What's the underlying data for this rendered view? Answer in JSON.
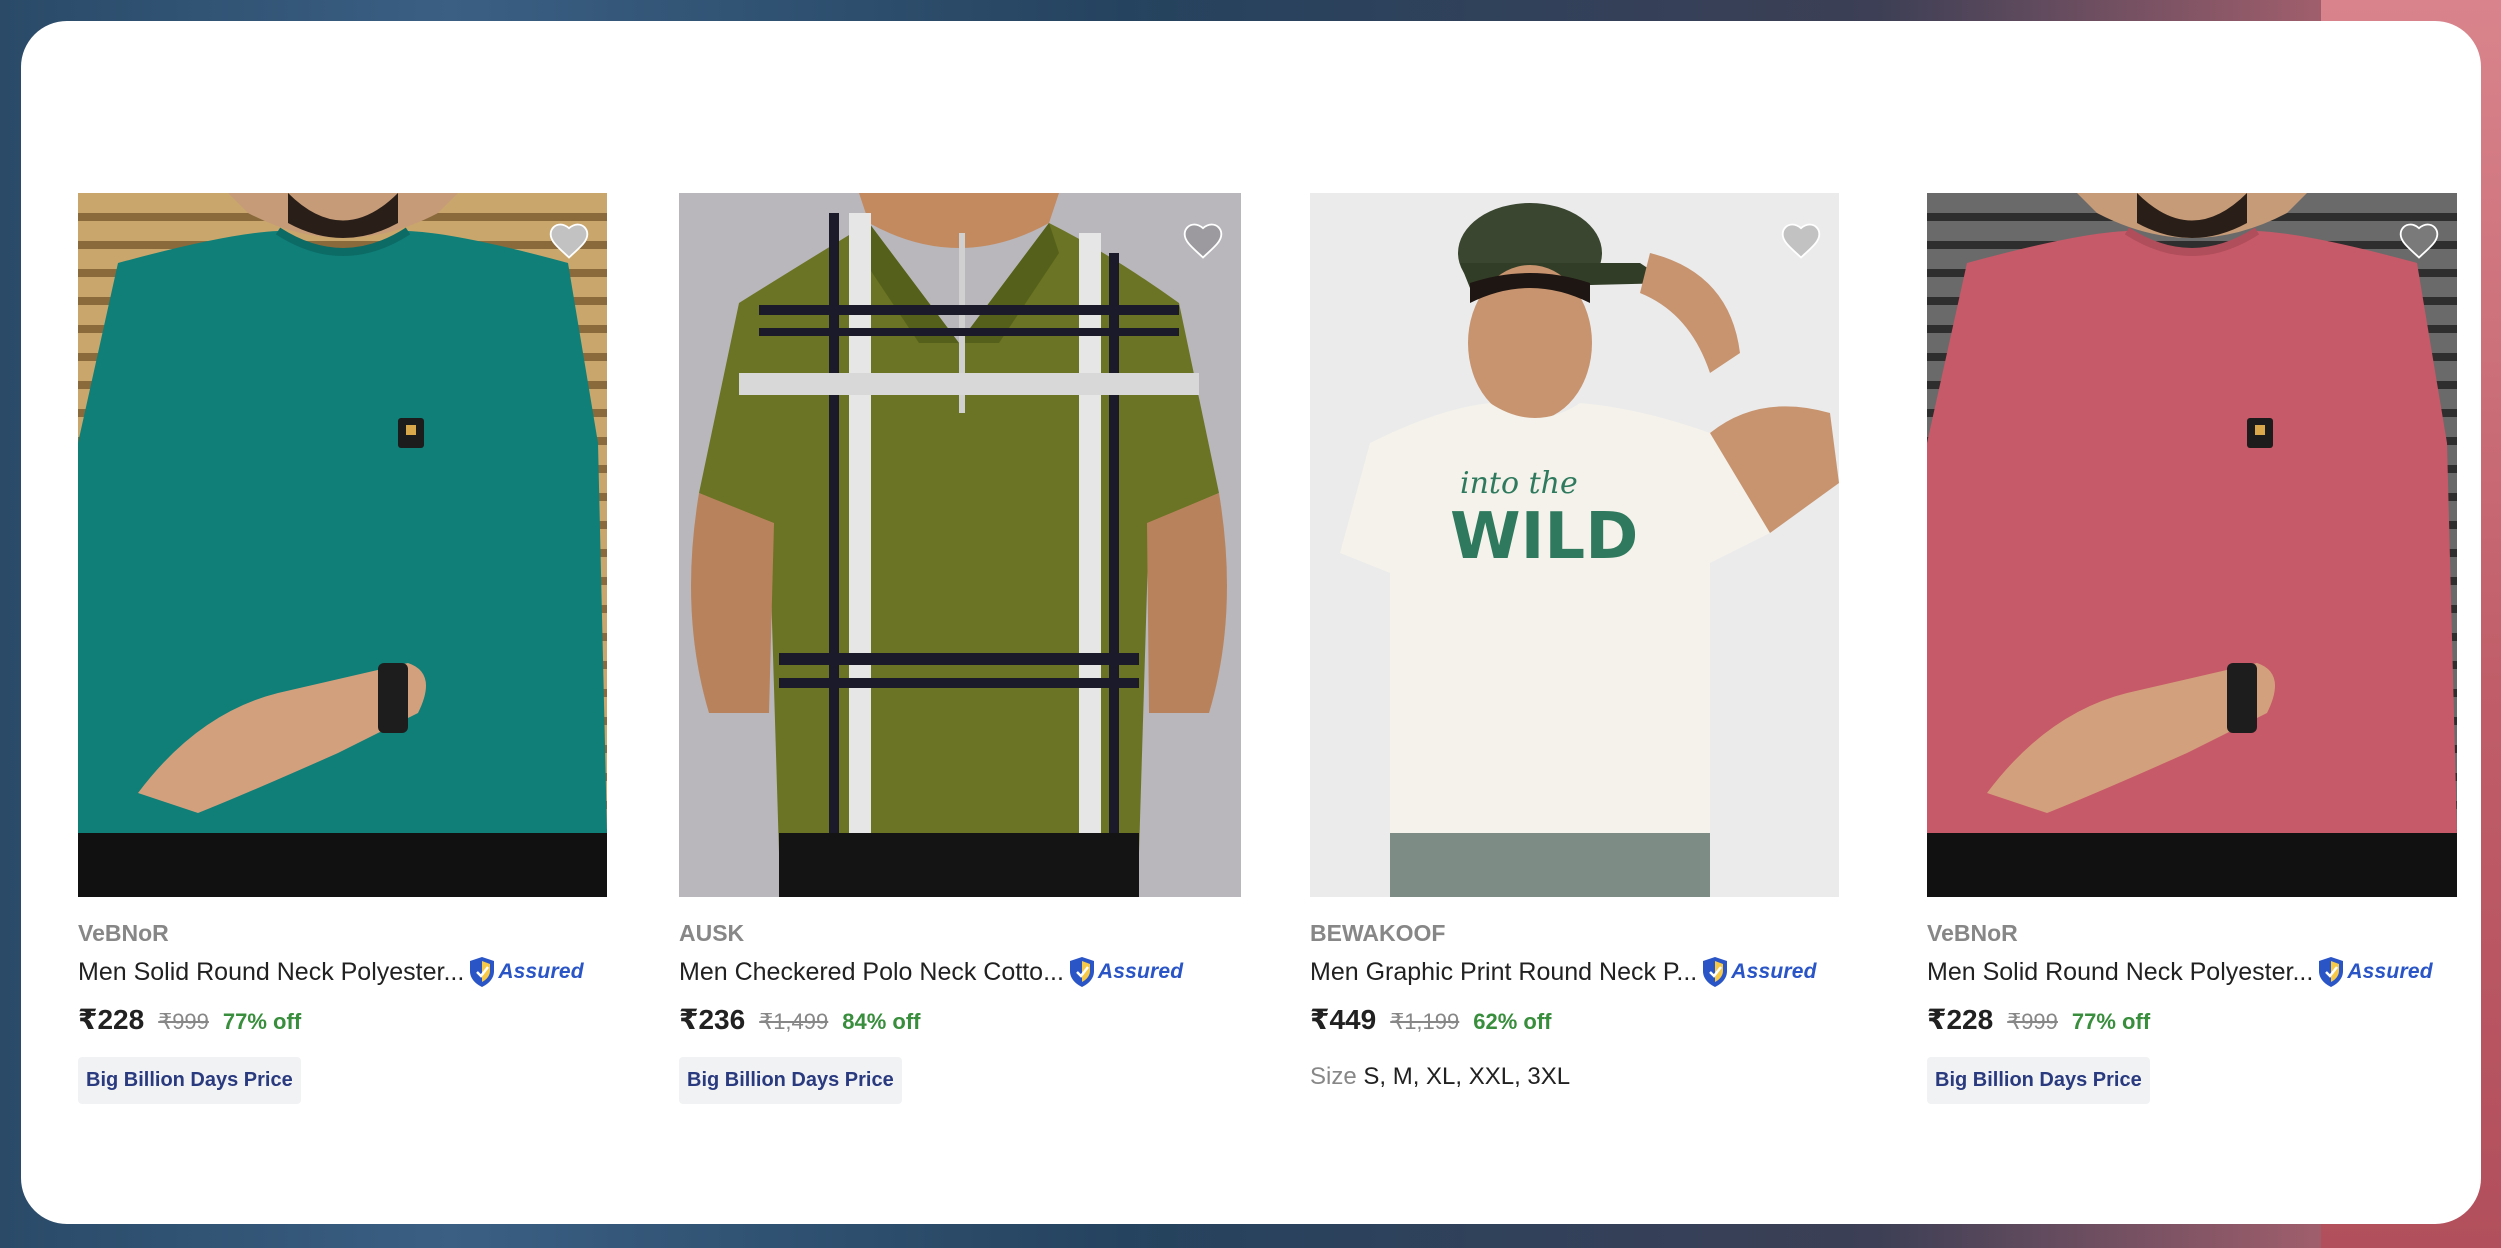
{
  "products": [
    {
      "brand": "VeBNoR",
      "title": "Men Solid Round Neck Polyester...",
      "assured_label": "Assured",
      "price": "₹228",
      "mrp": "₹999",
      "discount": "77% off",
      "tag": "Big Billion Days Price",
      "shirt_color": "#0f7f78"
    },
    {
      "brand": "AUSK",
      "title": "Men Checkered Polo Neck Cotto...",
      "assured_label": "Assured",
      "price": "₹236",
      "mrp": "₹1,499",
      "discount": "84% off",
      "tag": "Big Billion Days Price",
      "shirt_color": "#6b7424"
    },
    {
      "brand": "BEWAKOOF",
      "title": "Men Graphic Print Round Neck P...",
      "assured_label": "Assured",
      "price": "₹449",
      "mrp": "₹1,199",
      "discount": "62% off",
      "size_label": "Size",
      "sizes": "S, M, XL, XXL, 3XL",
      "print_script": "into the",
      "print_word": "WILD",
      "shirt_color": "#f4f2ea"
    },
    {
      "brand": "VeBNoR",
      "title": "Men Solid Round Neck Polyester...",
      "assured_label": "Assured",
      "price": "₹228",
      "mrp": "₹999",
      "discount": "77% off",
      "tag": "Big Billion Days Price",
      "shirt_color": "#c75a68"
    }
  ],
  "icons": {
    "wishlist": "heart-icon",
    "assured": "shield-icon"
  },
  "colors": {
    "discount_green": "#388e3c",
    "assured_blue": "#2a55c7",
    "tag_text": "#2a3a7e"
  }
}
